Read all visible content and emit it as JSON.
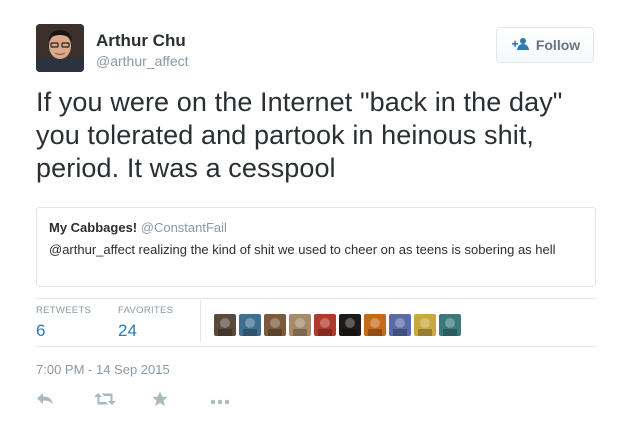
{
  "author": {
    "name": "Arthur Chu",
    "handle": "@arthur_affect",
    "avatar_icon": "profile-photo-avatar"
  },
  "follow_button": {
    "label": "Follow",
    "icon": "add-user-icon"
  },
  "tweet": {
    "text": "If you were on the Internet \"back in the day\" you tolerated and partook in heinous shit, period. It was a cesspool"
  },
  "quoted_tweet": {
    "name": "My Cabbages!",
    "handle": "@ConstantFail",
    "text": "@arthur_affect realizing the kind of shit we used to cheer on as teens is sobering as hell"
  },
  "stats": {
    "retweets_label": "RETWEETS",
    "retweets_value": "6",
    "favorites_label": "FAVORITES",
    "favorites_value": "24"
  },
  "favoriters": [
    {
      "icon": "favoriter-avatar-1",
      "color": "#5a4a3c"
    },
    {
      "icon": "favoriter-avatar-2",
      "color": "#3f6f8f"
    },
    {
      "icon": "favoriter-avatar-3",
      "color": "#7a5a3a"
    },
    {
      "icon": "favoriter-avatar-4",
      "color": "#a68a6a"
    },
    {
      "icon": "favoriter-avatar-5",
      "color": "#b03a2a"
    },
    {
      "icon": "favoriter-avatar-6",
      "color": "#1f1a1a"
    },
    {
      "icon": "favoriter-avatar-7",
      "color": "#c46a1a"
    },
    {
      "icon": "favoriter-avatar-8",
      "color": "#5b6aa8"
    },
    {
      "icon": "favoriter-avatar-9",
      "color": "#c8a840"
    },
    {
      "icon": "favoriter-avatar-10",
      "color": "#3a7a7a"
    }
  ],
  "timestamp": "7:00 PM - 14 Sep 2015",
  "actions": [
    {
      "icon": "reply-icon"
    },
    {
      "icon": "retweet-icon"
    },
    {
      "icon": "favorite-star-icon"
    },
    {
      "icon": "more-options-icon"
    }
  ]
}
